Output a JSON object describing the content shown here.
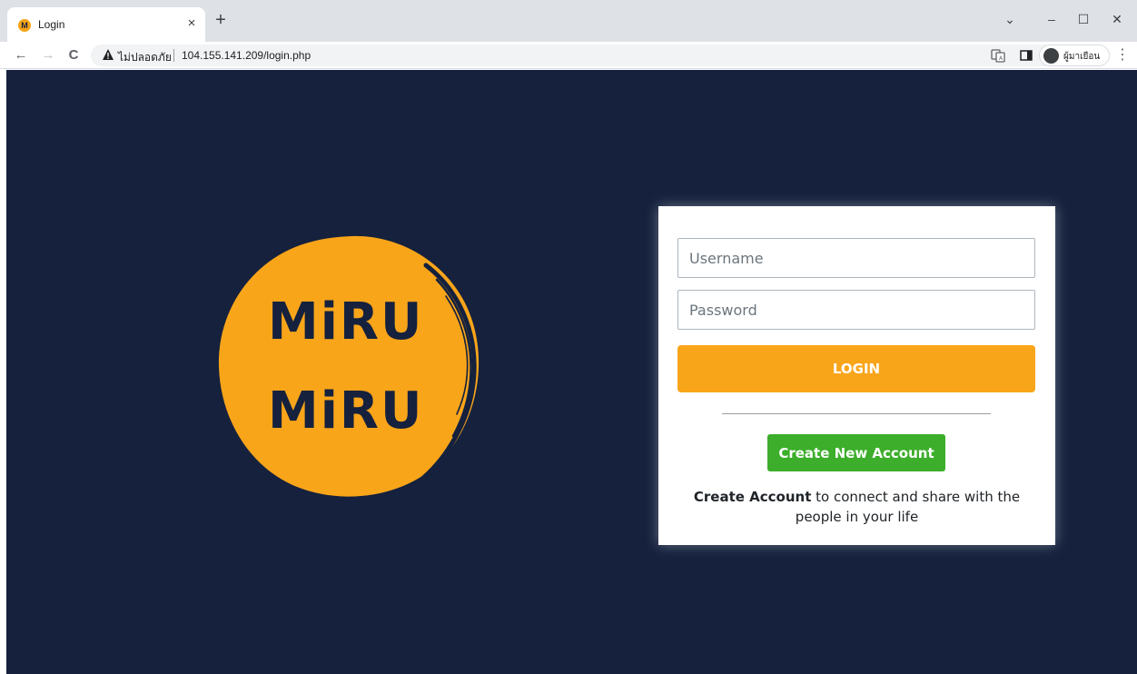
{
  "browser": {
    "tab_title": "Login",
    "tab_favicon_letter": "M",
    "tab_close": "×",
    "new_tab": "+",
    "security_label": "ไม่ปลอดภัย",
    "url": "104.155.141.209/login.php",
    "profile_label": "ผู้มาเยือน",
    "window_controls": {
      "dropdown": "⌄",
      "minimize": "–",
      "maximize": "☐",
      "close": "✕"
    },
    "nav": {
      "back": "←",
      "forward": "→",
      "reload": "C"
    },
    "menu": "⋮"
  },
  "logo": {
    "word_top": "MiRU",
    "word_bottom": "MiRU",
    "color": "#f9a51a"
  },
  "login_form": {
    "username_placeholder": "Username",
    "password_placeholder": "Password",
    "login_label": "LOGIN",
    "create_account_label": "Create New Account",
    "tagline_bold": "Create Account",
    "tagline_line1_rest": " to connect and share with the",
    "tagline_line2": "people in your life"
  },
  "colors": {
    "background": "#15213d",
    "accent": "#f9a51a",
    "create_button": "#3dae2b"
  }
}
